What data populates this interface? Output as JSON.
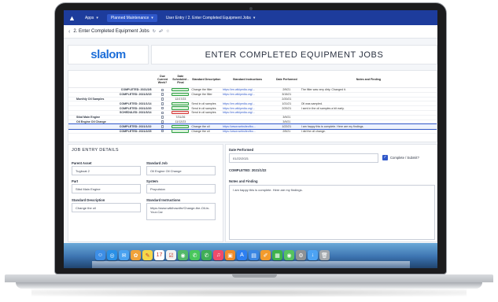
{
  "topbar": {
    "apps_label": "Apps",
    "workspace_label": "Planned Maintenance",
    "tab_label": "User Entry / 2. Enter Completed Equipment Jobs"
  },
  "subbar": {
    "title": "2. Enter Completed Equipment Jobs"
  },
  "banner": {
    "brand": "slalom",
    "title": "ENTER COMPLETED EQUIPMENT JOBS"
  },
  "table": {
    "headers": [
      "",
      "Due Current Week?",
      "Date Scheduled - Final",
      "Standard Description",
      "Standard Instructions",
      "Date Performed",
      "Notes and Finding"
    ],
    "rows": [
      {
        "c0": "COMPLETED: 2021/2/8",
        "due": "",
        "sched": "pill",
        "desc": "Change the filter",
        "instr": "https://en.wikipedia.org/...",
        "perf": "2/9/21",
        "notes": "The filter was very dirty. Changed it."
      },
      {
        "c0": "COMPLETED: 2021/3/15",
        "due": "",
        "sched": "pill",
        "desc": "Change the filter",
        "instr": "https://en.wikipedia.org/...",
        "perf": "3/15/21",
        "notes": ""
      },
      {
        "c0": "Monthly Oil Samples",
        "due": "",
        "sched": "12/17/23",
        "desc": "",
        "instr": "",
        "perf": "2/20/21",
        "notes": "",
        "left": true
      },
      {
        "c0": "COMPLETED: 2021/1/14",
        "due": "",
        "sched": "pill",
        "desc": "Send in oil samples",
        "instr": "https://en.wikipedia.org/...",
        "perf": "1/31/21",
        "notes": "Oil was sampled."
      },
      {
        "c0": "COMPLETED: 2021/2/20",
        "due": "",
        "sched": "pill",
        "desc": "Send in oil samples",
        "instr": "https://en.wikipedia.org/...",
        "perf": "2/20/21",
        "notes": "I sent in the oil samples a bit early."
      },
      {
        "c0": "SCHEDULED: 2021/3/14",
        "due": "",
        "sched": "pill-red",
        "desc": "Send in oil samples",
        "instr": "https://en.wikipedia.org/...",
        "perf": "",
        "notes": ""
      },
      {
        "c0": "Stbd Main Engine",
        "due": "",
        "sched": "7/31/26",
        "desc": "",
        "instr": "",
        "perf": "3/9/21",
        "notes": "",
        "left": true
      },
      {
        "c0": "Oil Engine Oil Change",
        "due": "",
        "sched": "11/12/23",
        "desc": "",
        "instr": "",
        "perf": "3/9/21",
        "notes": "",
        "left": true
      },
      {
        "c0": "COMPLETED: 2021/1/22",
        "due": "",
        "sched": "pill",
        "desc": "Change the oil",
        "instr": "https://www.websiteofbo...",
        "perf": "1/22/21",
        "notes": "I am happy this is complete. Here are my findings.",
        "selected": true
      },
      {
        "c0": "COMPLETED: 2021/2/25",
        "due": "",
        "sched": "pill",
        "desc": "Change the oil",
        "instr": "https://www.websiteofbo...",
        "perf": "2/5/21",
        "notes": "I did the oil change."
      }
    ]
  },
  "form": {
    "section_title": "JOB ENTRY DETAILS",
    "parent_asset_label": "Parent Asset",
    "parent_asset_value": "Tugboat 2",
    "standard_job_label": "Standard Job",
    "standard_job_value": "Oil Engine Oil Change",
    "part_label": "Part",
    "part_value": "Stbd Main Engine",
    "system_label": "System",
    "system_value": "Propulsion",
    "std_desc_label": "Standard Description",
    "std_desc_value": "Change the oil",
    "std_instr_label": "Standard Instructions",
    "std_instr_value": "https://www.wikihowdhr/Change-the-Oil-in-Your-Car",
    "date_performed_label": "Date Performed",
    "date_performed_value": "01/22/2021",
    "complete_label": "Complete / Submit?",
    "completed_status": "COMPLETED: 2021/1/22",
    "notes_label": "Notes and Finding",
    "notes_value": "I am happy this is complete.  Here are my findings."
  },
  "dock": {
    "icons": [
      "finder-icon",
      "safari-icon",
      "mail-icon",
      "photos-icon",
      "notes-icon",
      "calendar-icon",
      "reminders-icon",
      "maps-icon",
      "messages-icon",
      "facetime-icon",
      "music-icon",
      "books-icon",
      "app-store-icon",
      "keynote-icon",
      "pages-icon",
      "numbers-icon",
      "facetime-video-icon",
      "settings-icon",
      "downloads-icon",
      "trash-icon"
    ],
    "colors": [
      "#3d8ee6",
      "#2a90e6",
      "#4aa2f0",
      "#f0a23a",
      "#f5d64a",
      "#ffffff",
      "#f2f2f2",
      "#53b86a",
      "#48c75c",
      "#3fae57",
      "#ef4b6a",
      "#f08c2a",
      "#2e7ff0",
      "#3a86e3",
      "#f29b2c",
      "#3db24b",
      "#56c25f",
      "#8e9296",
      "#4da3f3",
      "#a3a8ad"
    ]
  }
}
